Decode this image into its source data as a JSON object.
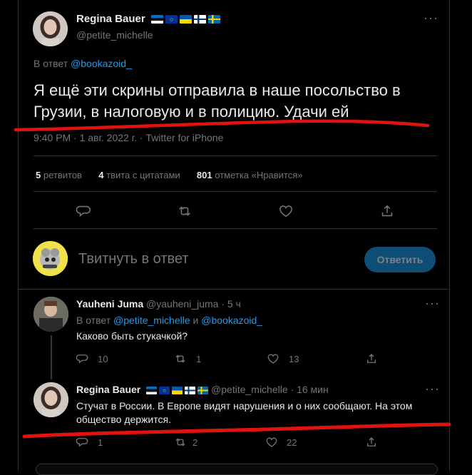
{
  "main_tweet": {
    "author_name": "Regina Bauer",
    "author_handle": "@petite_michelle",
    "reply_to_prefix": "В ответ",
    "reply_to_handle": "@bookazoid_",
    "text": "Я ещё эти скрины отправила в наше посольство в Грузии, в налоговую и в полицию. Удачи ей",
    "meta": "9:40 PM · 1 авг. 2022 г. · Twitter for iPhone",
    "stats": {
      "retweets_count": "5",
      "retweets_label": "ретвитов",
      "quotes_count": "4",
      "quotes_label": "твита с цитатами",
      "likes_count": "801",
      "likes_label": "отметка «Нравится»"
    }
  },
  "composer": {
    "placeholder": "Твитнуть в ответ",
    "button_label": "Ответить"
  },
  "replies": [
    {
      "author_name": "Yauheni Juma",
      "author_handle": "@yauheni_juma",
      "time": "· 5 ч",
      "reply_to_prefix": "В ответ",
      "reply_to_handle_1": "@petite_michelle",
      "reply_to_and": "и",
      "reply_to_handle_2": "@bookazoid_",
      "text": "Каково быть стукачкой?",
      "reply_count": "10",
      "retweet_count": "1",
      "like_count": "13"
    },
    {
      "author_name": "Regina Bauer",
      "author_handle": "@petite_michelle",
      "time": "· 16 мин",
      "text": "Стучат в России. В Европе видят нарушения и о них сообщают. На этом общество держится.",
      "reply_count": "1",
      "retweet_count": "2",
      "like_count": "22"
    }
  ],
  "colors": {
    "background": "#000000",
    "accent": "#1d9bf0",
    "annotation_red": "#e0130f"
  }
}
